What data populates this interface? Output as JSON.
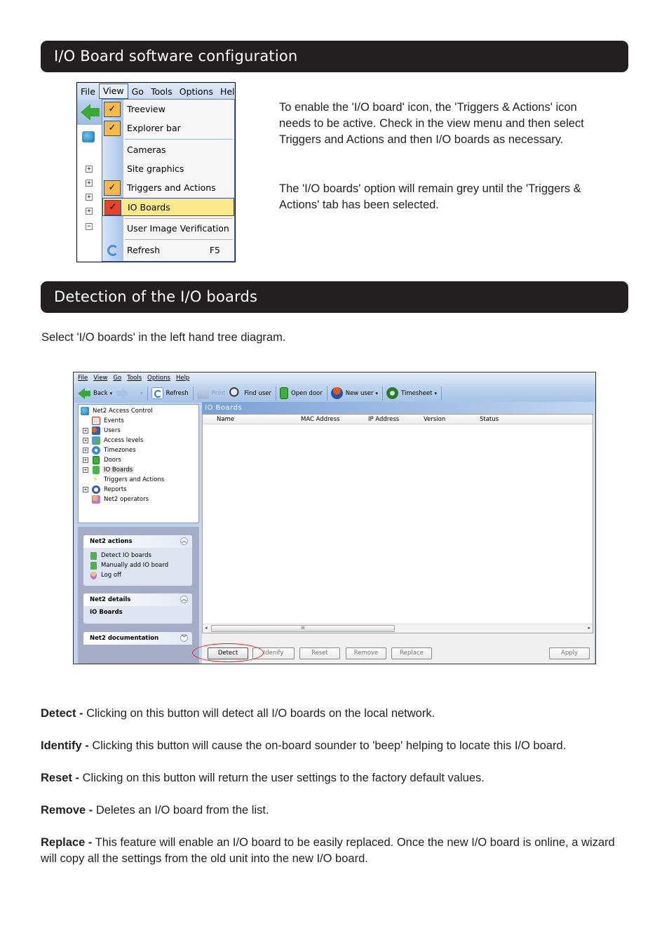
{
  "sections": {
    "software_config_title": "I/O Board software configuration",
    "detection_title": "Detection of the I/O boards"
  },
  "intro": {
    "paragraph1": "To enable the 'I/O board' icon, the 'Triggers & Actions' icon needs to be active. Check in the view menu and then select Triggers and Actions and then I/O boards as necessary.",
    "paragraph2": "The 'I/O boards' option will remain grey until the 'Triggers & Actions' tab has been selected."
  },
  "detection_instruction": "Select 'I/O boards' in the left hand tree diagram.",
  "view_menu_screenshot": {
    "menubar": [
      "File",
      "View",
      "Go",
      "Tools",
      "Options",
      "Hel"
    ],
    "active_menu": "View",
    "items": [
      {
        "label": "Treeview",
        "checked": true
      },
      {
        "label": "Explorer bar",
        "checked": true
      },
      {
        "label": "Cameras",
        "checked": false
      },
      {
        "label": "Site graphics",
        "checked": false
      },
      {
        "label": "Triggers and Actions",
        "checked": true
      },
      {
        "label": "IO Boards",
        "checked": true,
        "highlighted": true
      },
      {
        "label": "User Image Verification",
        "checked": false
      },
      {
        "label": "Refresh",
        "shortcut": "F5",
        "icon": "refresh-icon"
      }
    ],
    "checkmark": "✓",
    "tree_expanders": [
      "+",
      "+",
      "+",
      "+",
      "−"
    ]
  },
  "app_screenshot": {
    "menubar": [
      "File",
      "View",
      "Go",
      "Tools",
      "Options",
      "Help"
    ],
    "toolbar": {
      "back": "Back",
      "refresh": "Refresh",
      "print": "Print",
      "find_user": "Find user",
      "open_door": "Open door",
      "new_user": "New user",
      "timesheet": "Timesheet"
    },
    "tree": [
      {
        "label": "Net2 Access Control",
        "expander": "",
        "icon": "network-icon"
      },
      {
        "label": "Events",
        "expander": "",
        "icon": "calendar-icon"
      },
      {
        "label": "Users",
        "expander": "+",
        "icon": "users-icon"
      },
      {
        "label": "Access levels",
        "expander": "+",
        "icon": "access-levels-icon"
      },
      {
        "label": "Timezones",
        "expander": "+",
        "icon": "clock-icon"
      },
      {
        "label": "Doors",
        "expander": "+",
        "icon": "door-icon"
      },
      {
        "label": "IO Boards",
        "expander": "+",
        "icon": "io-board-icon",
        "selected": true
      },
      {
        "label": "Triggers and Actions",
        "expander": "",
        "icon": "lightning-icon"
      },
      {
        "label": "Reports",
        "expander": "+",
        "icon": "reports-icon"
      },
      {
        "label": "Net2 operators",
        "expander": "",
        "icon": "operators-icon"
      }
    ],
    "panels": {
      "actions": {
        "title": "Net2 actions",
        "items": [
          "Detect IO boards",
          "Manually add IO board",
          "Log off"
        ]
      },
      "details": {
        "title": "Net2 details",
        "value": "IO Boards"
      },
      "documentation": {
        "title": "Net2 documentation"
      }
    },
    "main_title": "IO Boards",
    "columns": [
      "Name",
      "MAC Address",
      "IP Address",
      "Version",
      "Status"
    ],
    "scroll_thumb_grip": "III",
    "buttons": {
      "detect": "Detect",
      "identify": "Idenify",
      "reset": "Reset",
      "remove": "Remove",
      "replace": "Replace",
      "apply": "Apply"
    },
    "highlight_color": "#e0201c"
  },
  "definitions": [
    {
      "term": "Detect -",
      "text": " Clicking on this button will detect all I/O boards on the local network."
    },
    {
      "term": "Identify -",
      "text": " Clicking this button will cause the on-board sounder to 'beep' helping to locate this I/O board."
    },
    {
      "term": "Reset -",
      "text": " Clicking on this button will return the user settings to the factory default values."
    },
    {
      "term": "Remove -",
      "text": " Deletes an I/O board from the list."
    },
    {
      "term": "Replace -",
      "text": " This feature will enable an I/O board to be easily replaced. Once the new I/O board is online, a wizard will copy all the settings from the old unit into the new I/O board."
    }
  ]
}
